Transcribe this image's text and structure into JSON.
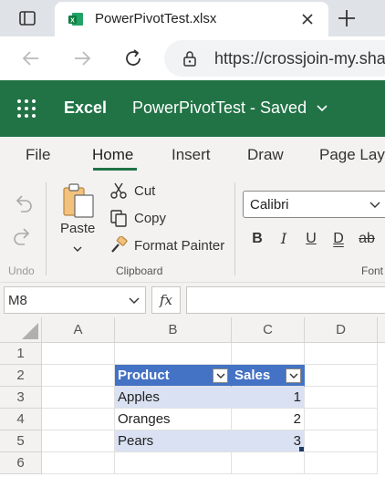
{
  "browser": {
    "tab_title": "PowerPivotTest.xlsx",
    "url": "https://crossjoin-my.sha"
  },
  "excel": {
    "app_name": "Excel",
    "doc_title": "PowerPivotTest",
    "doc_status": "Saved",
    "doc_title_full": "PowerPivotTest - Saved"
  },
  "ribbon_tabs": [
    "File",
    "Home",
    "Insert",
    "Draw",
    "Page Layo"
  ],
  "ribbon": {
    "undo_group": "Undo",
    "paste_label": "Paste",
    "cut_label": "Cut",
    "copy_label": "Copy",
    "format_painter_label": "Format Painter",
    "clipboard_group": "Clipboard",
    "font_name": "Calibri",
    "font_group": "Font",
    "bold": "B",
    "italic": "I",
    "underline": "U",
    "double_underline": "D",
    "strikethrough": "ab"
  },
  "formula_bar": {
    "name_box": "M8",
    "fx_label": "fx",
    "formula": ""
  },
  "grid": {
    "columns": [
      "A",
      "B",
      "C",
      "D"
    ],
    "rows": [
      "1",
      "2",
      "3",
      "4",
      "5",
      "6"
    ]
  },
  "table": {
    "headers": [
      "Product",
      "Sales"
    ],
    "rows": [
      {
        "product": "Apples",
        "sales": "1"
      },
      {
        "product": "Oranges",
        "sales": "2"
      },
      {
        "product": "Pears",
        "sales": "3"
      }
    ]
  },
  "colors": {
    "excel_green": "#217346",
    "table_header": "#4472c4",
    "table_band": "#d9e1f2"
  }
}
